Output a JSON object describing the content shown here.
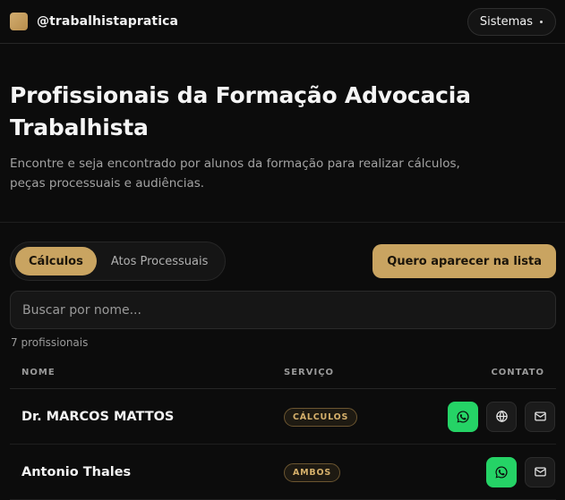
{
  "header": {
    "handle": "@trabalhistapratica",
    "systems_label": "Sistemas"
  },
  "hero": {
    "title": "Profissionais da Formação Advocacia Trabalhista",
    "subtitle": "Encontre e seja encontrado por alunos da formação para realizar cálculos, peças processuais e audiências."
  },
  "tabs": [
    {
      "label": "Cálculos",
      "active": true
    },
    {
      "label": "Atos Processuais",
      "active": false
    }
  ],
  "cta_label": "Quero aparecer na lista",
  "search": {
    "placeholder": "Buscar por nome...",
    "value": ""
  },
  "count_text": "7 profissionais",
  "table": {
    "columns": [
      "NOME",
      "SERVIÇO",
      "CONTATO"
    ],
    "rows": [
      {
        "name": "Dr. MARCOS MATTOS",
        "service": "CÁLCULOS",
        "contacts": [
          "whatsapp-icon",
          "globe-icon",
          "mail-icon"
        ]
      },
      {
        "name": "Antonio Thales",
        "service": "AMBOS",
        "contacts": [
          "whatsapp-icon",
          "mail-icon"
        ]
      }
    ]
  },
  "colors": {
    "accent": "#c9a461",
    "background": "#0c0c0c",
    "whatsapp": "#25d366"
  }
}
